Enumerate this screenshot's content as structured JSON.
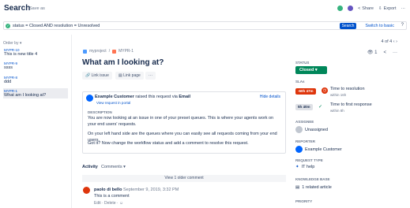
{
  "header": {
    "title": "Search",
    "save_as": "Save as",
    "share": "Share",
    "export": "Export"
  },
  "filter": {
    "query": "status = Closed AND resolution = Unresolved",
    "search_label": "Search",
    "switch_label": "Switch to basic",
    "help": "?"
  },
  "list": {
    "order_by": "Order by",
    "items": [
      {
        "key": "MYPR-10",
        "summary": "This is new title 4"
      },
      {
        "key": "MYPR-9",
        "summary": "ssss"
      },
      {
        "key": "MYPR-8",
        "summary": "ddd"
      },
      {
        "key": "MYPR-1",
        "summary": "What am I looking at?"
      }
    ]
  },
  "issue": {
    "project": "myproject",
    "sep": "/",
    "key": "MYPR-1",
    "title": "What am I looking at?",
    "link_issue": "Link issue",
    "link_page": "Link page",
    "more": "···",
    "counter": "4 of 4",
    "watchers": "1",
    "raised_prefix": "Example Customer",
    "raised_mid": " raised this request via ",
    "raised_via": "Email",
    "view_portal": "View request in portal",
    "hide_details": "Hide details",
    "description_heading": "DESCRIPTION",
    "description": [
      "You are now looking at an issue in one of your preset queues. This is where your agents work on your end users' requests.",
      "On your left hand side are the queues where you can easily see all requests coming from your end users.",
      "Got it? Now change the workflow status and add a comment to resolve this request."
    ]
  },
  "activity": {
    "label": "Activity",
    "filter": "Comments",
    "older": "View 1 older comment",
    "comment": {
      "author": "paolo di bello",
      "date": "September 9, 2019, 3:32 PM",
      "body": "This is a comment",
      "actions": "Edit · Delete · ☺"
    }
  },
  "panel": {
    "status_heading": "STATUS",
    "status": "Closed",
    "slas_heading": "SLAs",
    "sla": [
      {
        "pill": "-60h 47m",
        "title": "Time to resolution",
        "sub": "within 16h",
        "color": "#de350b"
      },
      {
        "pill": "5h 40m",
        "title": "Time to first response",
        "sub": "within 8h",
        "color": "#dfe1e6"
      }
    ],
    "assignee_heading": "ASSIGNEE",
    "assignee": "Unassigned",
    "reporter_heading": "REPORTER",
    "reporter": "Example Customer",
    "request_type_heading": "REQUEST TYPE",
    "request_type": "IT help",
    "kb_heading": "KNOWLEDGE BASE",
    "kb": "1 related article",
    "priority_heading": "PRIORITY"
  },
  "colors": {
    "accent": "#0052cc",
    "status_closed": "#00875a",
    "sla_breach": "#de350b"
  }
}
